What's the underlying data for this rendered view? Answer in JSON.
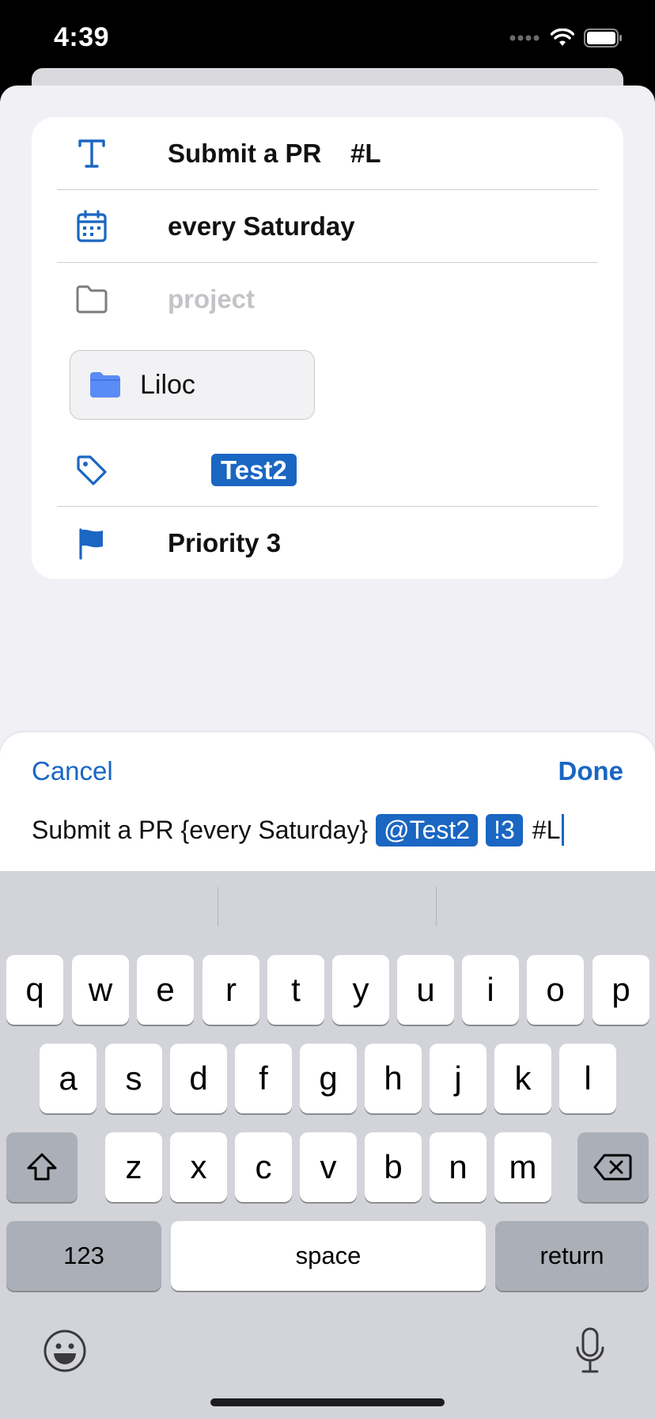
{
  "status": {
    "time": "4:39"
  },
  "detail": {
    "title": "Submit a PR    #L",
    "due": "every Saturday",
    "project_placeholder": "project",
    "project_suggestion": "Liloc",
    "tag": "Test2",
    "priority": "Priority 3"
  },
  "editor": {
    "cancel": "Cancel",
    "done": "Done",
    "input_text": "Submit a PR {every Saturday}",
    "tag_pill": "@Test2",
    "priority_pill": "!3",
    "tail": "#L"
  },
  "keyboard": {
    "row1": [
      "q",
      "w",
      "e",
      "r",
      "t",
      "y",
      "u",
      "i",
      "o",
      "p"
    ],
    "row2": [
      "a",
      "s",
      "d",
      "f",
      "g",
      "h",
      "j",
      "k",
      "l"
    ],
    "row3": [
      "z",
      "x",
      "c",
      "v",
      "b",
      "n",
      "m"
    ],
    "numbers": "123",
    "space": "space",
    "return": "return"
  },
  "colors": {
    "accent": "#1a66c2",
    "folder": "#5a8cf5"
  },
  "icons": [
    "text-icon",
    "calendar-icon",
    "folder-outline-icon",
    "folder-filled-icon",
    "tag-icon",
    "flag-icon",
    "shift-icon",
    "delete-icon",
    "emoji-icon",
    "microphone-icon",
    "wifi-icon",
    "battery-icon",
    "signal-icon"
  ]
}
